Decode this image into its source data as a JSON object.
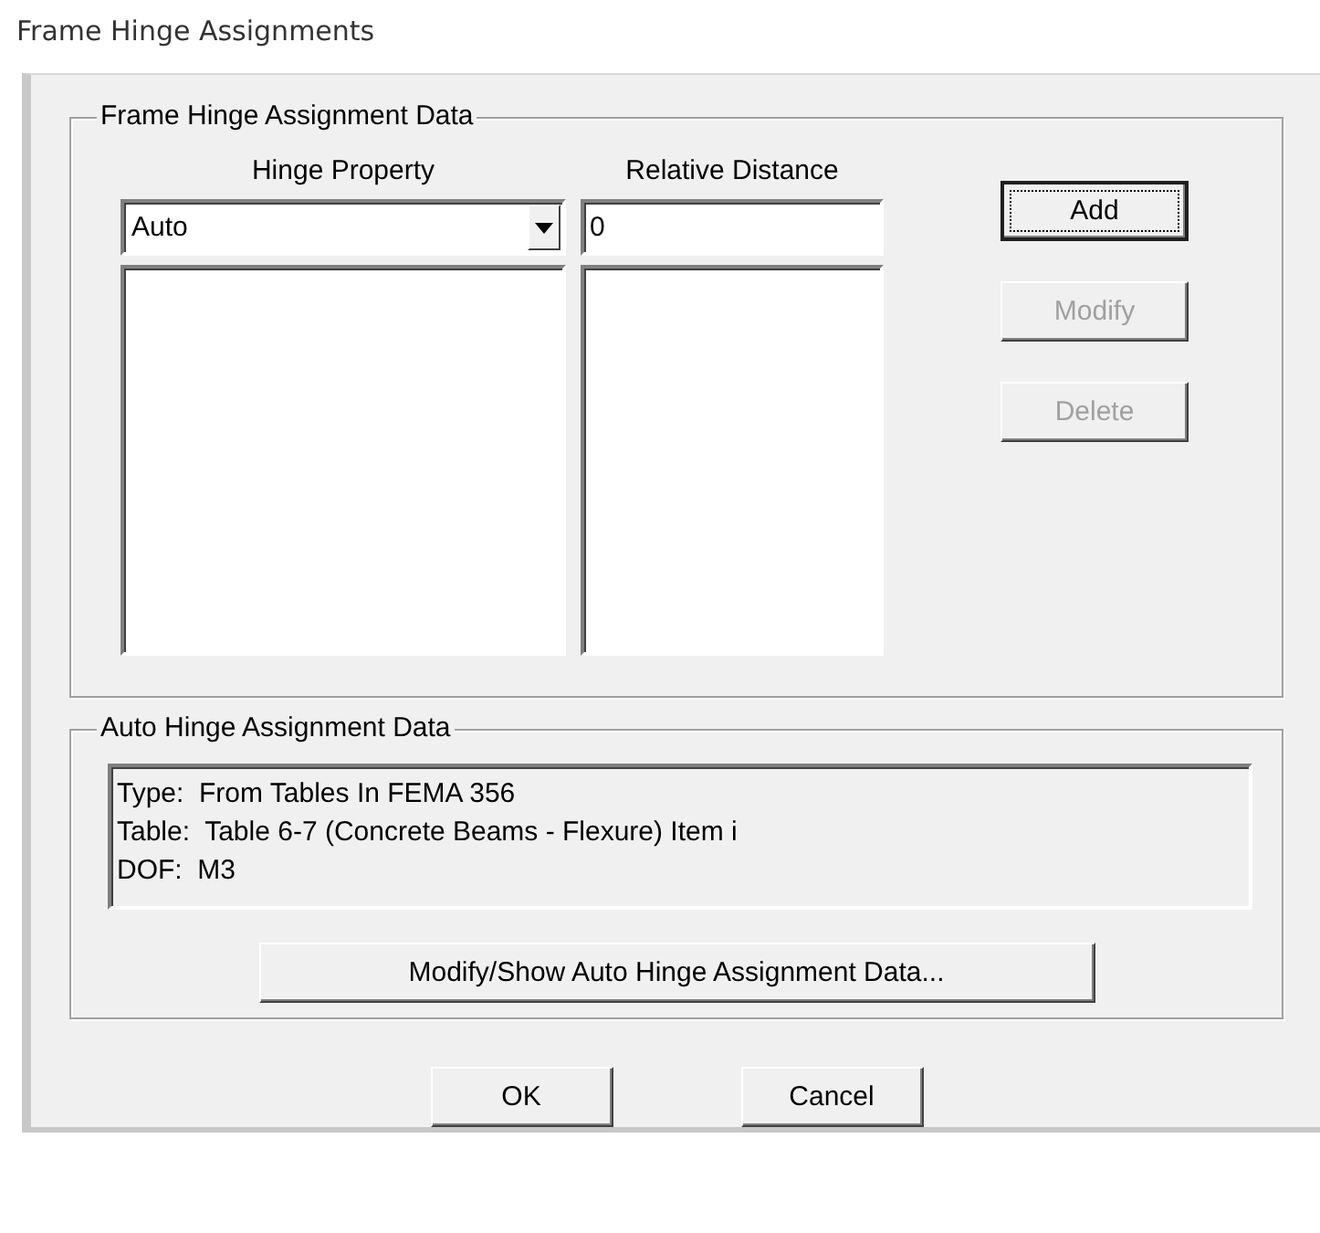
{
  "window": {
    "title": "Frame Hinge Assignments"
  },
  "hinge_group": {
    "title": "Frame Hinge Assignment Data",
    "columns": [
      "Hinge Property",
      "Relative Distance"
    ],
    "hinge_property": {
      "value": "Auto"
    },
    "relative_distance": {
      "value": "0"
    },
    "buttons": [
      {
        "label": "Add",
        "disabled": false,
        "focused": true
      },
      {
        "label": "Modify",
        "disabled": true,
        "focused": false
      },
      {
        "label": "Delete",
        "disabled": true,
        "focused": false
      }
    ]
  },
  "auto_group": {
    "title": "Auto Hinge Assignment Data",
    "lines": [
      "Type:  From Tables In FEMA 356",
      "Table:  Table 6-7 (Concrete Beams - Flexure) Item i",
      "DOF:  M3"
    ],
    "button": "Modify/Show Auto Hinge Assignment Data..."
  },
  "footer_buttons": [
    "OK",
    "Cancel"
  ]
}
